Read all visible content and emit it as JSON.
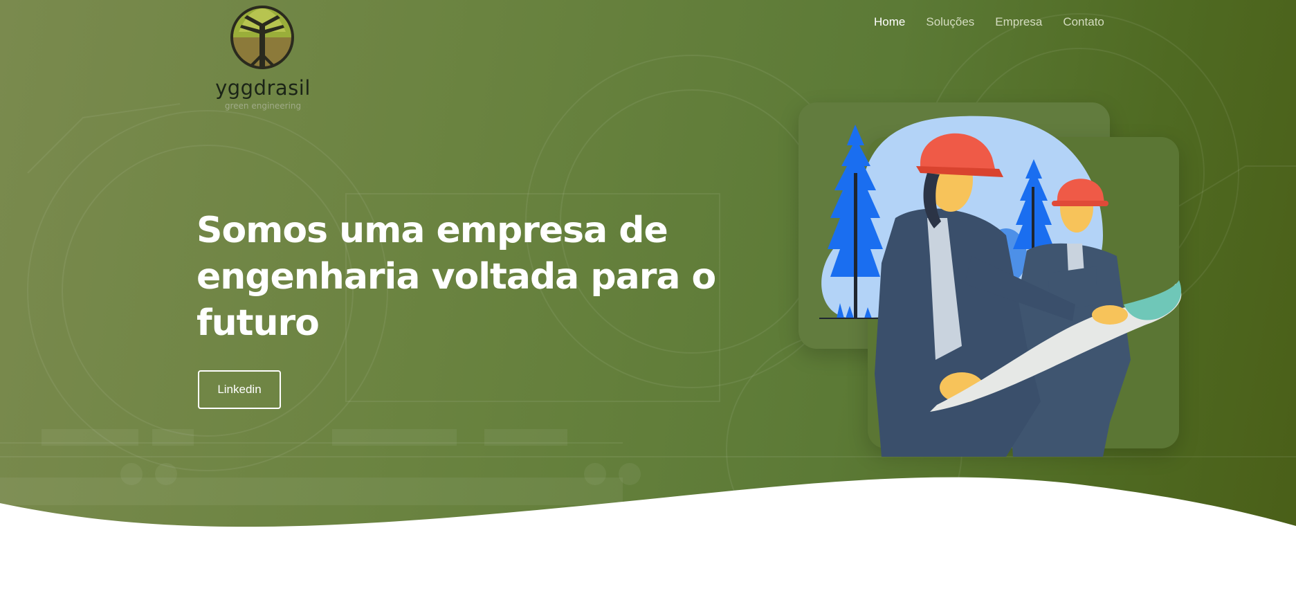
{
  "brand": {
    "name": "yggdrasil",
    "tagline": "green engineering",
    "logo_icon": "tree-icon"
  },
  "nav": {
    "items": [
      {
        "label": "Home",
        "active": true
      },
      {
        "label": "Soluções",
        "active": false
      },
      {
        "label": "Empresa",
        "active": false
      },
      {
        "label": "Contato",
        "active": false
      }
    ]
  },
  "hero": {
    "headline_line1": "Somos uma empresa de",
    "headline_line2": "engenharia voltada para o",
    "headline_line3": "futuro",
    "cta_label": "Linkedin",
    "illustration": "engineers-with-blueprint-illustration"
  },
  "colors": {
    "hero_start": "#7a8a4e",
    "hero_end": "#4a5f18",
    "helmet": "#ef5a47",
    "tree": "#1a6ef0",
    "suit": "#3f5570",
    "blueprint": "#e6e8e6"
  }
}
